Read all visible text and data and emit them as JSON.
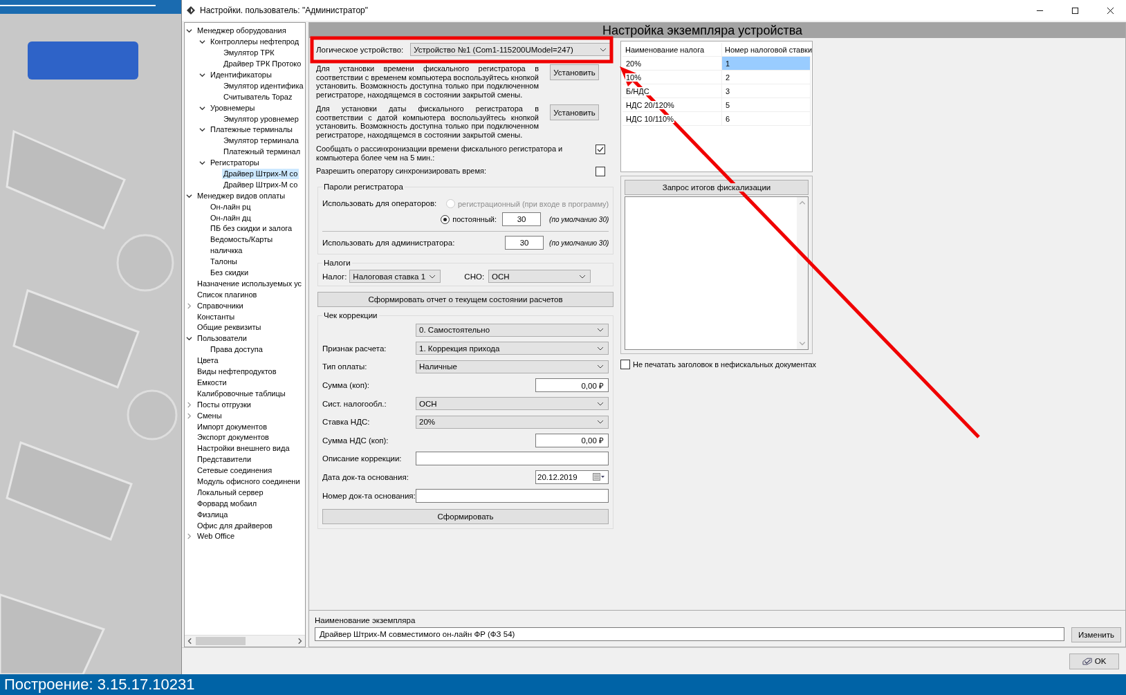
{
  "window": {
    "title": "Настройки. пользователь: \"Администратор\""
  },
  "tree": {
    "items": [
      {
        "label": "Менеджер оборудования",
        "expanded": true,
        "selected": false,
        "children": [
          {
            "label": "Контроллеры нефтепрод",
            "expanded": true,
            "selected": false,
            "children": [
              {
                "label": "Эмулятор ТРК",
                "selected": false
              },
              {
                "label": "Драйвер ТРК Протоко",
                "selected": false
              }
            ]
          },
          {
            "label": "Идентификаторы",
            "expanded": true,
            "selected": false,
            "children": [
              {
                "label": "Эмулятор идентифика",
                "selected": false
              },
              {
                "label": "Считыватель Topaz",
                "selected": false
              }
            ]
          },
          {
            "label": "Уровнемеры",
            "expanded": true,
            "selected": false,
            "children": [
              {
                "label": "Эмулятор уровнемер",
                "selected": false
              }
            ]
          },
          {
            "label": "Платежные терминалы",
            "expanded": true,
            "selected": false,
            "children": [
              {
                "label": "Эмулятор терминала",
                "selected": false
              },
              {
                "label": "Платежный терминал",
                "selected": false
              }
            ]
          },
          {
            "label": "Регистраторы",
            "expanded": true,
            "selected": false,
            "children": [
              {
                "label": "Драйвер Штрих-М со",
                "selected": true
              },
              {
                "label": "Драйвер Штрих-М со",
                "selected": false
              }
            ]
          }
        ]
      },
      {
        "label": "Менеджер видов оплаты",
        "expanded": true,
        "selected": false,
        "children": [
          {
            "label": "Он-лайн рц",
            "selected": false
          },
          {
            "label": "Он-лайн дц",
            "selected": false
          },
          {
            "label": "ПБ без скидки и залога",
            "selected": false
          },
          {
            "label": "Ведомость/Карты",
            "selected": false
          },
          {
            "label": "наличкка",
            "selected": false
          },
          {
            "label": "Талоны",
            "selected": false
          },
          {
            "label": "Без скидки",
            "selected": false
          }
        ]
      },
      {
        "label": "Назначение используемых ус",
        "selected": false
      },
      {
        "label": "Список плагинов",
        "selected": false
      },
      {
        "label": "Справочники",
        "expanded": false,
        "selected": false
      },
      {
        "label": "Константы",
        "selected": false
      },
      {
        "label": "Общие реквизиты",
        "selected": false
      },
      {
        "label": "Пользователи",
        "expanded": true,
        "selected": false,
        "children": [
          {
            "label": "Права доступа",
            "selected": false
          }
        ]
      },
      {
        "label": "Цвета",
        "selected": false
      },
      {
        "label": "Виды нефтепродуктов",
        "selected": false
      },
      {
        "label": "Емкости",
        "selected": false
      },
      {
        "label": "Калибровочные таблицы",
        "selected": false
      },
      {
        "label": "Посты отгрузки",
        "expanded": false,
        "selected": false
      },
      {
        "label": "Смены",
        "expanded": false,
        "selected": false
      },
      {
        "label": "Импорт документов",
        "selected": false
      },
      {
        "label": "Экспорт документов",
        "selected": false
      },
      {
        "label": "Настройки внешнего вида",
        "selected": false
      },
      {
        "label": "Представители",
        "selected": false
      },
      {
        "label": "Сетевые соединения",
        "selected": false
      },
      {
        "label": "Модуль офисного соединени",
        "selected": false
      },
      {
        "label": "Локальный сервер",
        "selected": false
      },
      {
        "label": "Форвард мобаил",
        "selected": false
      },
      {
        "label": "Физлица",
        "selected": false
      },
      {
        "label": "Офис для драйверов",
        "selected": false
      },
      {
        "label": "Web Office",
        "expanded": false,
        "selected": false
      }
    ]
  },
  "panel_title": "Настройка экземпляра устройства",
  "device": {
    "label": "Логическое устройство:",
    "value": "Устройство №1 (Com1-115200UModel=247)"
  },
  "sync": [
    {
      "text": "Для установки времени фискального регистратора в соответствии с временем компьютера воспользуйтесь кнопкой установить. Возможность доступна только при подключенном регистраторе, находящемся в состоянии закрытой смены.",
      "button": "Установить"
    },
    {
      "text": "Для установки даты фискального регистратора в соответствии с датой компьютера воспользуйтесь кнопкой установить. Возможность доступна только при подключенном регистраторе, находящемся в состоянии закрытой смены.",
      "button": "Установить"
    }
  ],
  "options": [
    {
      "label": "Сообщать о рассинхронизации времени фискального регистратора и компьютера более чем на 5 мин.:",
      "checked": true
    },
    {
      "label": "Разрешить оператору синхронизировать время:",
      "checked": false
    }
  ],
  "passwords": {
    "title": "Пароли регистратора",
    "operators_label": "Использовать для операторов:",
    "modes": [
      {
        "label": "регистрационный (при входе в программу)",
        "selected": false,
        "disabled": true
      },
      {
        "label": "постоянный:",
        "selected": true,
        "disabled": false,
        "value": "30",
        "hint": "(по умолчанию 30)"
      }
    ],
    "admin": {
      "label": "Использовать для администратора:",
      "value": "30",
      "hint": "(по умолчанию 30)"
    }
  },
  "taxes": {
    "title": "Налоги",
    "tax_label": "Налог:",
    "tax_value": "Налоговая ставка 1",
    "sno_label": "СНО:",
    "sno_value": "ОСН"
  },
  "report_button": "Сформировать отчет о текущем состоянии расчетов",
  "correction": {
    "title": "Чек коррекции",
    "fields": [
      {
        "kind": "select",
        "value": "0. Самостоятельно"
      },
      {
        "kind": "select",
        "label": "Признак расчета:",
        "value": "1. Коррекция прихода"
      },
      {
        "kind": "select",
        "label": "Тип оплаты:",
        "value": "Наличные"
      },
      {
        "kind": "amount",
        "label": "Сумма (коп):",
        "value": "0,00 ₽"
      },
      {
        "kind": "select",
        "label": "Сист. налогообл.:",
        "value": "ОСН"
      },
      {
        "kind": "select",
        "label": "Ставка НДС:",
        "value": "20%"
      },
      {
        "kind": "amount",
        "label": "Сумма НДС (коп):",
        "value": "0,00 ₽"
      },
      {
        "kind": "text",
        "label": "Описание коррекции:"
      },
      {
        "kind": "date",
        "label": "Дата док-та основания:",
        "value": "20.12.2019"
      },
      {
        "kind": "text",
        "label": "Номер док-та основания:"
      }
    ],
    "button": "Сформировать"
  },
  "tax_table": {
    "columns": [
      "Наименование налога",
      "Номер налоговой ставки"
    ],
    "rows": [
      {
        "cells": [
          "20%",
          "1"
        ],
        "selected": true
      },
      {
        "cells": [
          "10%",
          "2"
        ],
        "selected": false
      },
      {
        "cells": [
          "Б/НДС",
          "3"
        ],
        "selected": false
      },
      {
        "cells": [
          "НДС 20/120%",
          "5"
        ],
        "selected": false
      },
      {
        "cells": [
          "НДС 10/110%",
          "6"
        ],
        "selected": false
      }
    ]
  },
  "fiscal_query_button": "Запрос итогов фискализации",
  "no_header": {
    "label": "Не печатать заголовок в нефискальных документах",
    "checked": false
  },
  "instance": {
    "label": "Наименование экземпляра",
    "value": "Драйвер Штрих-М совместимого он-лайн ФР (ФЗ 54)",
    "button": "Изменить"
  },
  "ok_button": "OK",
  "build_label": "Построение: 3.15.17.10231"
}
